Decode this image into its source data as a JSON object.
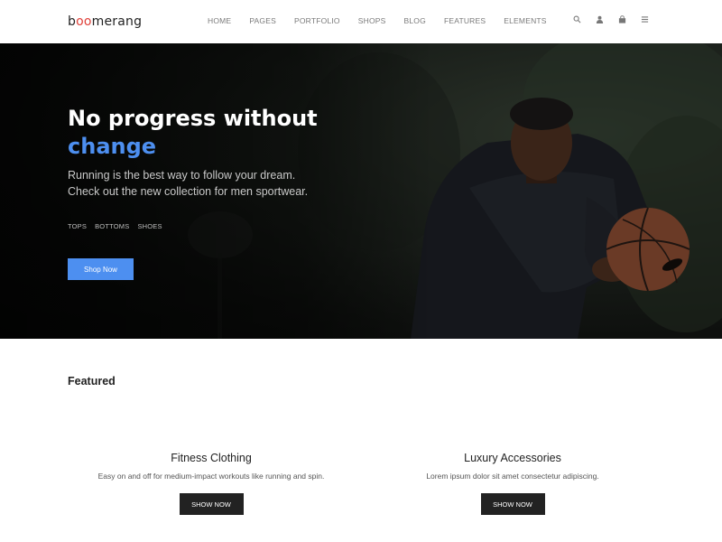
{
  "brand": {
    "logo_prefix": "b",
    "logo_oo": "oo",
    "logo_suffix": "merang",
    "accent_color": "#4d8ff0",
    "logo_accent_color": "#e0413a"
  },
  "nav": {
    "items": [
      {
        "label": "HOME"
      },
      {
        "label": "PAGES"
      },
      {
        "label": "PORTFOLIO"
      },
      {
        "label": "SHOPS"
      },
      {
        "label": "BLOG"
      },
      {
        "label": "FEATURES"
      },
      {
        "label": "ELEMENTS"
      }
    ],
    "icons": [
      "search-icon",
      "user-icon",
      "cart-icon",
      "menu-icon"
    ]
  },
  "hero": {
    "title_line1": "No progress without",
    "title_line2": "change",
    "subtitle_line1": "Running is the best way to follow your dream.",
    "subtitle_line2": "Check out the new collection for men sportwear.",
    "tags": [
      "TOPS",
      "BOTTOMS",
      "SHOES"
    ],
    "button_label": "Shop Now"
  },
  "featured": {
    "heading": "Featured",
    "cards": [
      {
        "title": "Fitness Clothing",
        "description": "Easy on and off for medium-impact workouts like running and spin.",
        "button_label": "SHOW NOW"
      },
      {
        "title": "Luxury Accessories",
        "description": "Lorem ipsum dolor sit amet consectetur adipiscing.",
        "button_label": "SHOW NOW"
      }
    ]
  }
}
